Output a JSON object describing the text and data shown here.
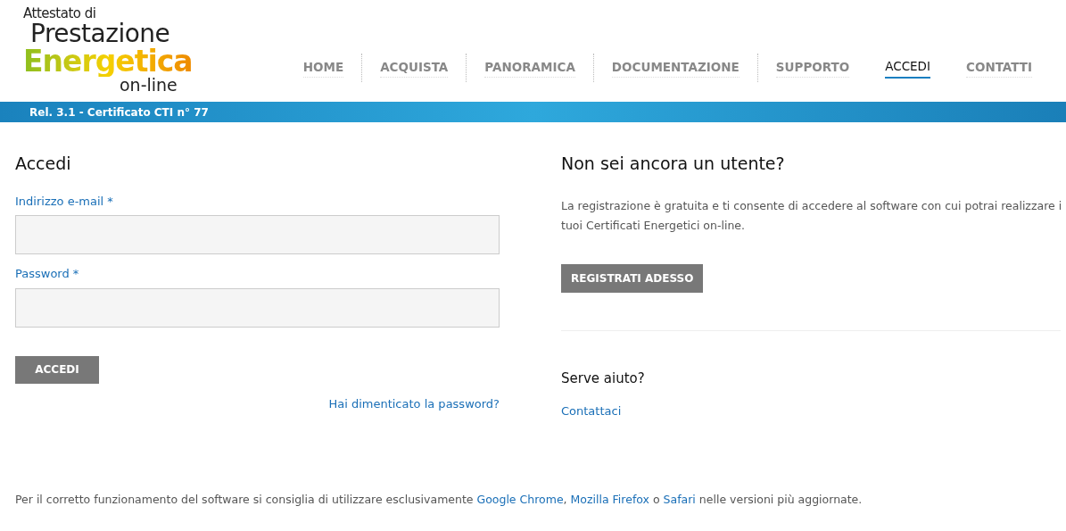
{
  "logo": {
    "line_1": "Attestato di",
    "line_2": "Prestazione",
    "line_3": "Energetica",
    "line_4": "on-line"
  },
  "nav": [
    {
      "label": "HOME",
      "selected": false
    },
    {
      "label": "ACQUISTA",
      "selected": false
    },
    {
      "label": "PANORAMICA",
      "selected": false
    },
    {
      "label": "DOCUMENTAZIONE",
      "selected": false
    },
    {
      "label": "SUPPORTO",
      "selected": false
    },
    {
      "label": "ACCEDI",
      "selected": true
    },
    {
      "label": "CONTATTI",
      "selected": false
    }
  ],
  "banner": "Rel. 3.1 - Certificato CTI n° 77",
  "login": {
    "title": "Accedi",
    "fields": [
      {
        "label": "Indirizzo e-mail *"
      },
      {
        "label": "Password *"
      }
    ],
    "button": "ACCEDI",
    "forgot_link": "Hai dimenticato la password?"
  },
  "register": {
    "title": "Non sei ancora un utente?",
    "text": "La registrazione è gratuita e ti consente di accedere al software con cui potrai realizzare i tuoi Certificati Energetici on-line.",
    "button": "REGISTRATI ADESSO",
    "help_title": "Serve aiuto?",
    "help_link": "Contattaci"
  },
  "footer": [
    {
      "kind": "text",
      "text": "Per il corretto funzionamento del software si consiglia di utilizzare esclusivamente "
    },
    {
      "kind": "link",
      "text": "Google Chrome"
    },
    {
      "kind": "text",
      "text": ", "
    },
    {
      "kind": "link",
      "text": "Mozilla Firefox"
    },
    {
      "kind": "text",
      "text": " o "
    },
    {
      "kind": "link",
      "text": "Safari"
    },
    {
      "kind": "text",
      "text": " nelle versioni più aggiornate."
    }
  ]
}
